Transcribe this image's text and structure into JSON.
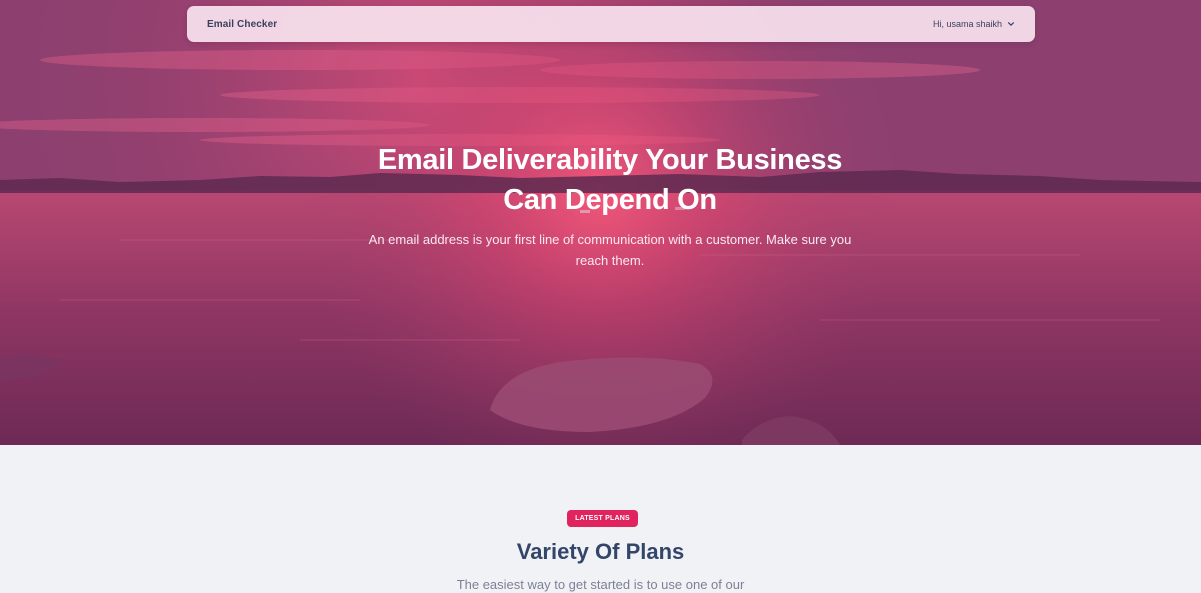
{
  "navbar": {
    "brand": "Email Checker",
    "user_greeting": "Hi, usama shaikh",
    "user_menu_icon": "chevron-down-icon"
  },
  "hero": {
    "title_line1": "Email Deliverability Your Business",
    "title_line2": "Can Depend On",
    "subtitle": "An email address is your first line of communication with a customer. Make sure you reach them."
  },
  "plans": {
    "badge": "LATEST PLANS",
    "title": "Variety Of Plans",
    "subtitle": "The easiest way to get started is to use one of our"
  },
  "colors": {
    "hero_overlay": "#9c3e6a",
    "badge": "#e0245e",
    "plans_title": "#34456a",
    "page_bg": "#f1f2f5"
  }
}
